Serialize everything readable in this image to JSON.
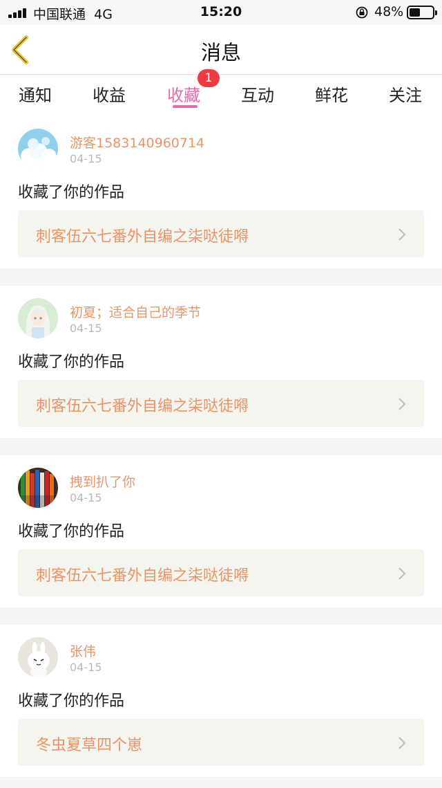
{
  "status_bar": {
    "carrier": "中国联通",
    "network": "4G",
    "time": "15:20",
    "battery_percent": "48%",
    "battery_level": 0.48
  },
  "nav": {
    "title": "消息"
  },
  "tabs": [
    {
      "label": "通知"
    },
    {
      "label": "收益"
    },
    {
      "label": "收藏",
      "active": true,
      "badge": "1"
    },
    {
      "label": "互动"
    },
    {
      "label": "鲜花"
    },
    {
      "label": "关注"
    }
  ],
  "messages": [
    {
      "username": "游客1583140960714",
      "date": "04-15",
      "action": "收藏了你的作品",
      "work_title": "刺客伍六七番外自编之柒哒徒嘚",
      "avatar": "clouds-avatar"
    },
    {
      "username": "初夏；适合自己的季节",
      "date": "04-15",
      "action": "收藏了你的作品",
      "work_title": "刺客伍六七番外自编之柒哒徒嘚",
      "avatar": "anime-girl-avatar"
    },
    {
      "username": "拽到扒了你",
      "date": "04-15",
      "action": "收藏了你的作品",
      "work_title": "刺客伍六七番外自编之柒哒徒嘚",
      "avatar": "colored-pencils-avatar"
    },
    {
      "username": "张伟",
      "date": "04-15",
      "action": "收藏了你的作品",
      "work_title": "冬虫夏草四个崽",
      "avatar": "rabbit-avatar"
    }
  ],
  "colors": {
    "accent_pink": "#e66ba8",
    "username_orange": "#e89468",
    "badge_red": "#ee3a40",
    "back_yellow": "#e8c53a"
  }
}
